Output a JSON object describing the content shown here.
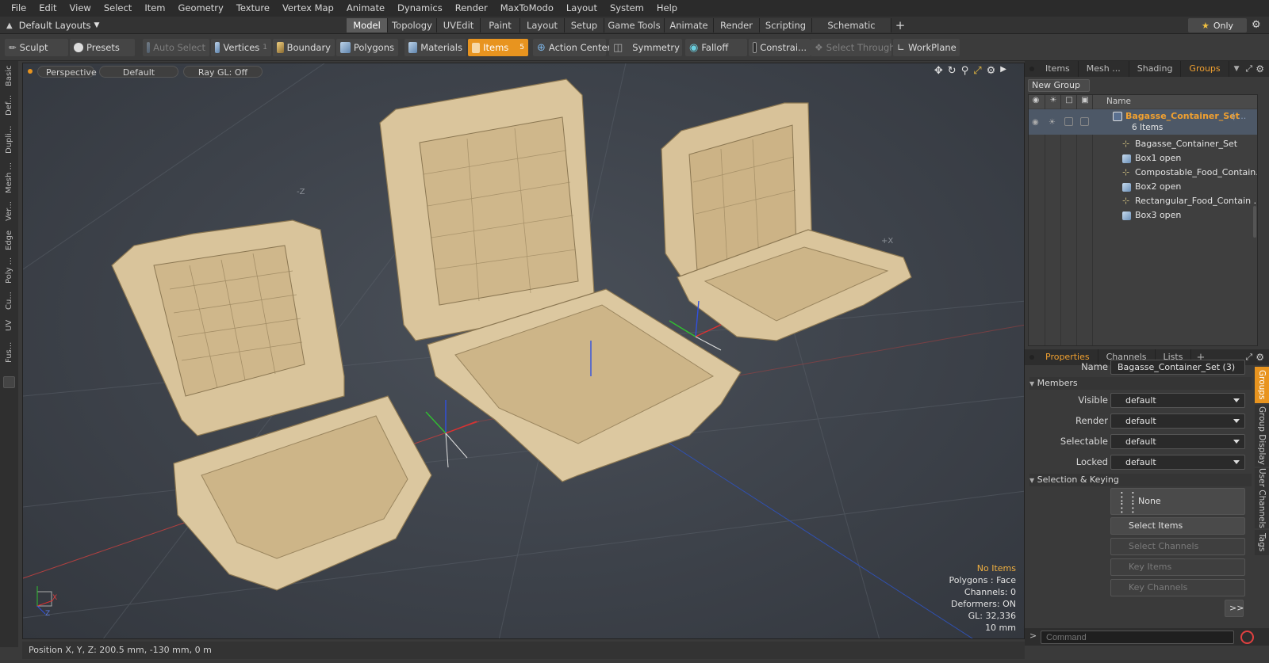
{
  "menubar": {
    "items": [
      "File",
      "Edit",
      "View",
      "Select",
      "Item",
      "Geometry",
      "Texture",
      "Vertex Map",
      "Animate",
      "Dynamics",
      "Render",
      "MaxToModo",
      "Layout",
      "System",
      "Help"
    ]
  },
  "layoutbar": {
    "layout_dropdown": "Default Layouts",
    "tabs": [
      "Model",
      "Topology",
      "UVEdit",
      "Paint",
      "Layout",
      "Setup",
      "Game Tools",
      "Animate",
      "Render",
      "Scripting",
      "Schematic Fusion"
    ],
    "active_tab": "Model",
    "only_label": "Only"
  },
  "toolbar": {
    "sculpt": "Sculpt",
    "presets": "Presets",
    "auto_select": "Auto Select",
    "vertices": "Vertices",
    "vertices_count": "1",
    "boundary": "Boundary",
    "polygons": "Polygons",
    "materials": "Materials",
    "items": "Items",
    "items_count": "5",
    "action_center": "Action Center",
    "symmetry": "Symmetry",
    "falloff": "Falloff",
    "constraints": "Constrai...",
    "select_through": "Select Through",
    "workplane": "WorkPlane"
  },
  "left_tabs": [
    "Basic",
    "Def...",
    "Dupli...",
    "Mesh ...",
    "Ver...",
    "Edge",
    "Poly ...",
    "Cu...",
    "UV",
    "Fus..."
  ],
  "viewport": {
    "view_mode": "Perspective",
    "shading": "Default",
    "raygl": "Ray GL: Off",
    "stats": {
      "selection": "No Items",
      "polygons": "Polygons : Face",
      "channels": "Channels: 0",
      "deformers": "Deformers: ON",
      "gl": "GL: 32,336",
      "unit": "10 mm"
    },
    "axis_labels": {
      "z": "Z",
      "x": "X",
      "neg_z": "-Z",
      "pos_x": "+X"
    }
  },
  "statusbar": {
    "position": "Position X, Y, Z:  200.5 mm, -130 mm, 0 m"
  },
  "right_panel": {
    "tabs": [
      "Items",
      "Mesh ...",
      "Shading",
      "Groups"
    ],
    "active_tab": "Groups",
    "new_group": "New Group",
    "tree_header": "Name",
    "group": {
      "name": "Bagasse_Container_Set",
      "suffix": "( ...",
      "count": "6 Items"
    },
    "children": [
      {
        "name": "Bagasse_Container_Set",
        "type": "locator"
      },
      {
        "name": "Box1 open",
        "type": "mesh"
      },
      {
        "name": "Compostable_Food_Contain...",
        "type": "locator"
      },
      {
        "name": "Box2 open",
        "type": "mesh"
      },
      {
        "name": "Rectangular_Food_Contain ...",
        "type": "locator"
      },
      {
        "name": "Box3 open",
        "type": "mesh"
      }
    ],
    "prop_tabs": [
      "Properties",
      "Channels",
      "Lists"
    ],
    "active_prop_tab": "Properties",
    "name_label": "Name",
    "name_value": "Bagasse_Container_Set (3)",
    "members_section": "Members",
    "fields": [
      {
        "label": "Visible",
        "value": "default"
      },
      {
        "label": "Render",
        "value": "default"
      },
      {
        "label": "Selectable",
        "value": "default"
      },
      {
        "label": "Locked",
        "value": "default"
      }
    ],
    "selection_section": "Selection & Keying",
    "none_button": "None",
    "buttons": [
      "Select Items",
      "Select Channels",
      "Key Items",
      "Key Channels"
    ],
    "more_button": ">>",
    "vertical_tabs": [
      "Groups",
      "Group Display",
      "User Channels",
      "Tags"
    ],
    "command_placeholder": "Command"
  },
  "colors": {
    "accent": "#e8941f",
    "model": "#d8c39a",
    "wire": "#8a7550"
  }
}
